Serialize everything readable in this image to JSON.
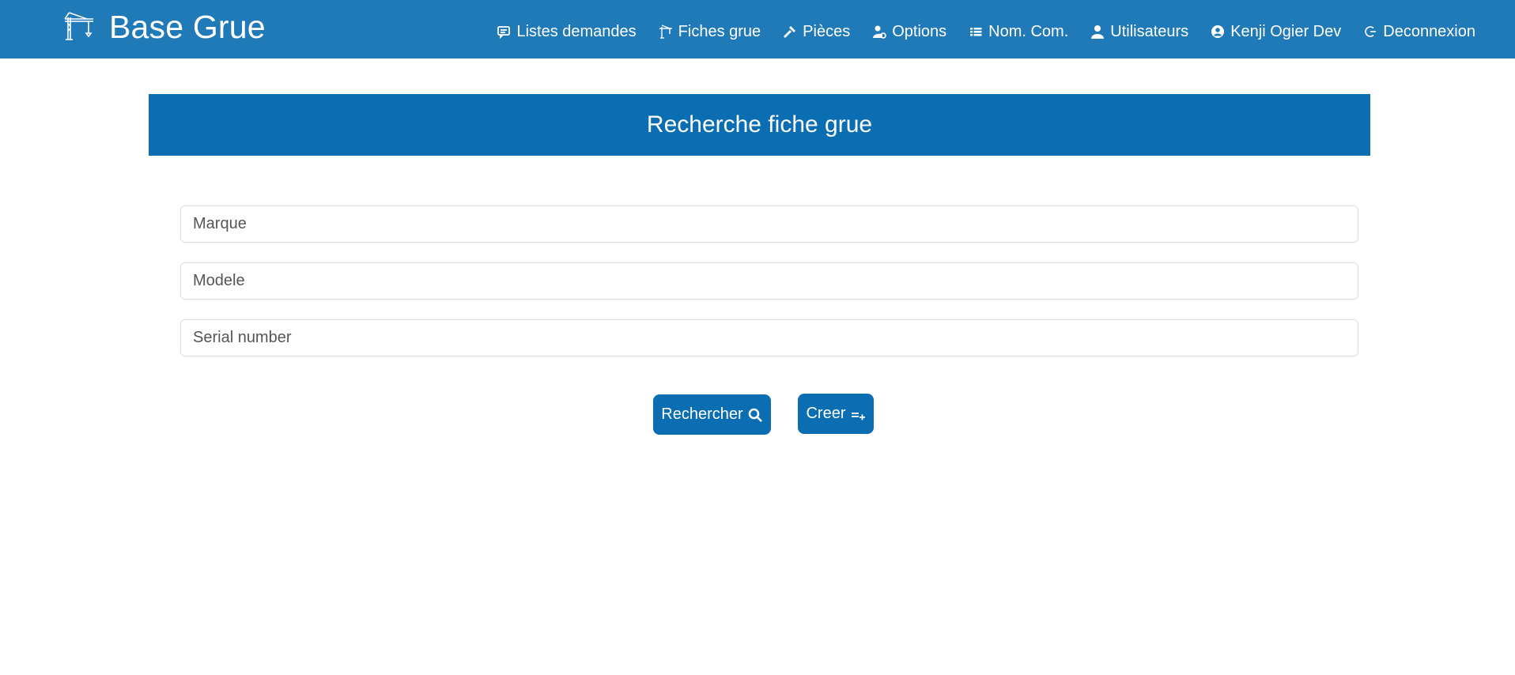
{
  "app": {
    "brand": "Base Grue",
    "brand_icon": "crane-icon"
  },
  "nav": {
    "items": [
      {
        "label": "Listes demandes",
        "icon": "message-icon"
      },
      {
        "label": "Fiches grue",
        "icon": "crane-icon"
      },
      {
        "label": "Pièces",
        "icon": "hammer-icon"
      },
      {
        "label": "Options",
        "icon": "user-gear-icon"
      },
      {
        "label": "Nom. Com.",
        "icon": "list-icon"
      },
      {
        "label": "Utilisateurs",
        "icon": "user-icon"
      },
      {
        "label": "Kenji Ogier Dev",
        "icon": "user-circle-icon"
      },
      {
        "label": "Deconnexion",
        "icon": "logout-icon"
      }
    ]
  },
  "page": {
    "title": "Recherche fiche grue"
  },
  "form": {
    "marque_placeholder": "Marque",
    "modele_placeholder": "Modele",
    "serial_placeholder": "Serial number",
    "search_label": "Rechercher",
    "create_label": "Creer"
  },
  "colors": {
    "navbar": "#207ab8",
    "accent": "#0b6db2",
    "text_on_accent": "#ffffff"
  }
}
